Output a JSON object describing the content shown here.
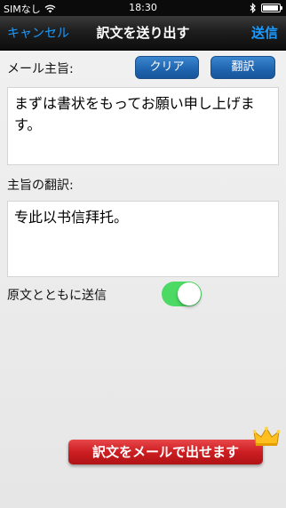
{
  "status_bar": {
    "carrier": "SIMなし",
    "time": "18:30"
  },
  "navbar": {
    "cancel_label": "キャンセル",
    "title": "訳文を送り出す",
    "send_label": "送信"
  },
  "main": {
    "message_label": "メール主旨:",
    "clear_label": "クリア",
    "translate_label": "翻訳",
    "message_text": "まずは書状をもってお願い申し上げます。",
    "translation_label": "主旨の翻訳:",
    "translation_text": "专此以书信拜托。",
    "send_with_original_label": "原文とともに送信",
    "send_with_original_on": true
  },
  "promo": {
    "label": "訳文をメールで出せます"
  },
  "colors": {
    "accent": "#1a9bff",
    "button": "#2066b0",
    "toggle_on": "#4cd964",
    "promo": "#cc1e22"
  },
  "icons": [
    "wifi-icon",
    "bluetooth-icon",
    "battery-icon",
    "crown-icon"
  ]
}
